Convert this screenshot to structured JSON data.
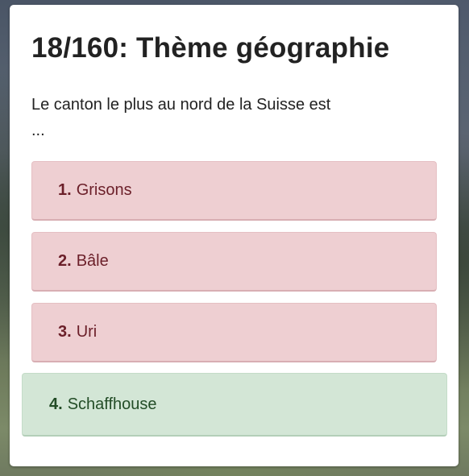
{
  "quiz": {
    "title": "18/160: Thème géographie",
    "question_line1": "Le canton le plus au nord de la Suisse est",
    "question_line2": "...",
    "answers": [
      {
        "number": "1.",
        "label": "Grisons",
        "state": "wrong"
      },
      {
        "number": "2.",
        "label": "Bâle",
        "state": "wrong"
      },
      {
        "number": "3.",
        "label": "Uri",
        "state": "wrong"
      },
      {
        "number": "4.",
        "label": "Schaffhouse",
        "state": "correct"
      }
    ]
  },
  "colors": {
    "wrong_bg": "#eecfd2",
    "wrong_text": "#6b1f29",
    "correct_bg": "#d3e6d6",
    "correct_text": "#234d27"
  }
}
